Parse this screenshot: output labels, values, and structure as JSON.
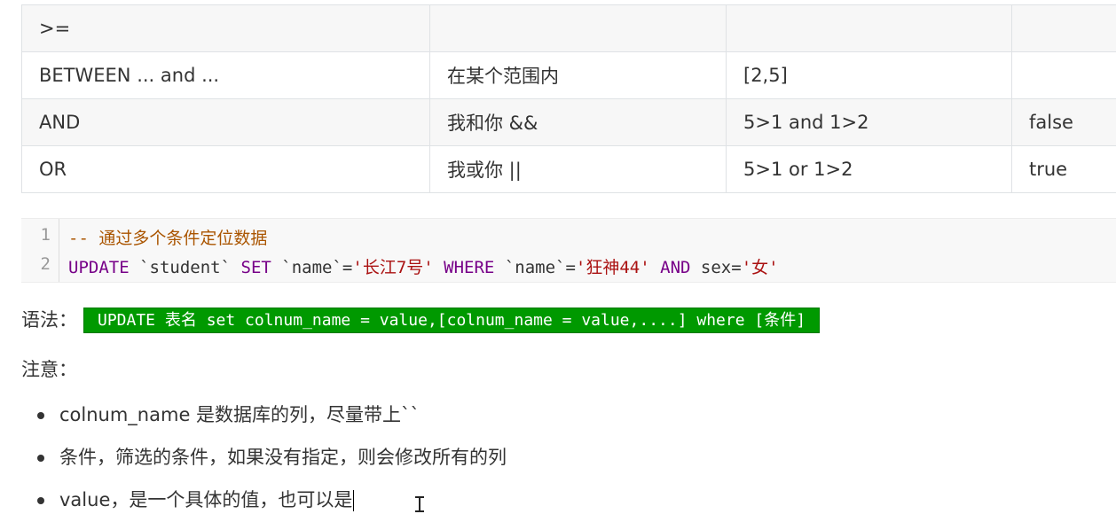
{
  "table": {
    "rows": [
      [
        "",
        "",
        "",
        ""
      ],
      [
        ">=",
        "",
        "",
        ""
      ],
      [
        "BETWEEN ...  and ...",
        "在某个范围内",
        "[2,5]",
        ""
      ],
      [
        "AND",
        "我和你 &&",
        "5>1 and 1>2",
        "false"
      ],
      [
        "OR",
        "我或你 ||",
        "5>1 or  1>2",
        "true"
      ]
    ]
  },
  "code": {
    "line_numbers": [
      "1",
      "2"
    ],
    "line1": {
      "comment": "-- 通过多个条件定位数据"
    },
    "line2": {
      "kw_update": "UPDATE",
      "table_name": "`student`",
      "kw_set": "SET",
      "col1": "`name`",
      "eq1": "=",
      "val1": "'长江7号'",
      "kw_where": "WHERE",
      "col2": "`name`",
      "eq2": "=",
      "val2": "'狂神44'",
      "kw_and": "AND",
      "col3": "sex",
      "eq3": "=",
      "val3": "'女'"
    }
  },
  "syntax": {
    "label": "语法：",
    "code": "UPDATE 表名 set colnum_name = value,[colnum_name = value,....] where [条件]"
  },
  "notes": {
    "label": "注意：",
    "items": [
      "colnum_name  是数据库的列，尽量带上``",
      "条件，筛选的条件，如果没有指定，则会修改所有的列",
      "value，是一个具体的值，也可以是"
    ]
  },
  "colors": {
    "syntax_bg": "#009900",
    "keyword": "#770088",
    "string": "#aa1111",
    "comment": "#aa5500"
  }
}
